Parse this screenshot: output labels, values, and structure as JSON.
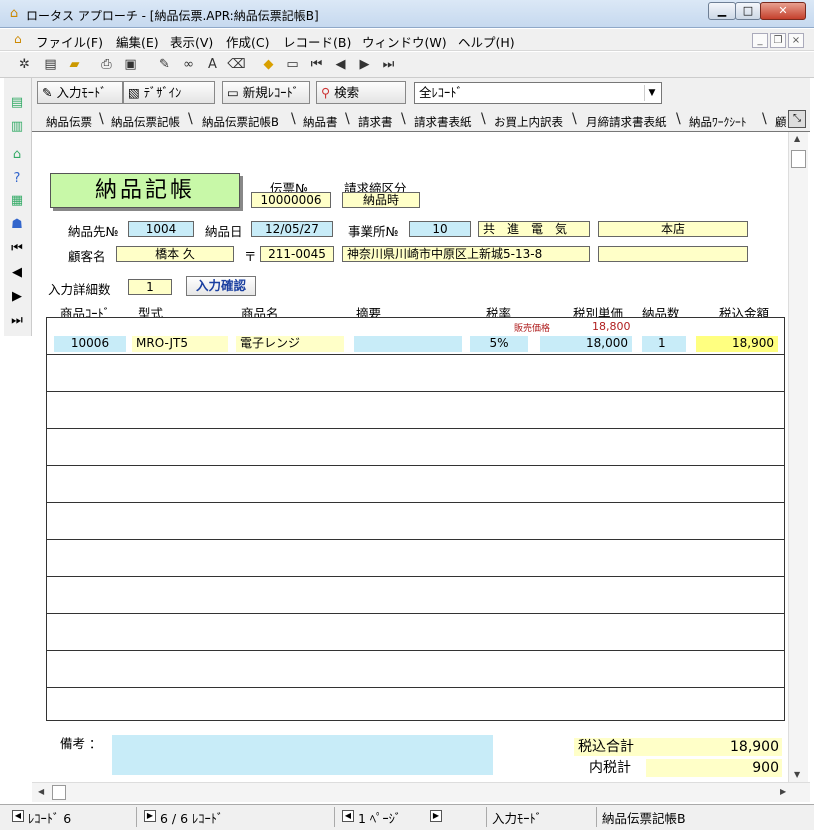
{
  "window": {
    "title": "ロータス アプローチ - [納品伝票.APR:納品伝票記帳B]",
    "min": "▁",
    "max": "□",
    "close": "✕"
  },
  "menu": [
    "ファイル(F)",
    "編集(E)",
    "表示(V)",
    "作成(C)",
    "レコード(B)",
    "ウィンドウ(W)",
    "ヘルプ(H)"
  ],
  "mdi": {
    "min": "_",
    "restore": "❐",
    "close": "×"
  },
  "toolbar2": {
    "input_mode": "入力ﾓｰﾄﾞ",
    "design": "ﾃﾞｻﾞｲﾝ",
    "new_record": "新規ﾚｺｰﾄﾞ",
    "search": "検索",
    "record_filter": "全ﾚｺｰﾄﾞ"
  },
  "tabs": [
    "納品伝票",
    "納品伝票記帳",
    "納品伝票記帳B",
    "納品書",
    "請求書",
    "請求書表紙",
    "お買上内訳表",
    "月締請求書表紙",
    "納品ﾜｰｸｼｰﾄ",
    "顧"
  ],
  "form": {
    "title": "納品記帳",
    "voucher_no_label": "伝票№",
    "voucher_no": "10000006",
    "billing_label": "請求締区分",
    "billing": "納品時",
    "delivery_to_label": "納品先№",
    "delivery_to": "1004",
    "delivery_date_label": "納品日",
    "delivery_date": "12/05/27",
    "office_label": "事業所№",
    "office_no": "10",
    "company": "共　進　電　気",
    "branch": "本店",
    "customer_label": "顧客名",
    "customer": "橋本 久",
    "postal_mark": "〒",
    "postal": "211-0045",
    "address": "神奈川県川崎市中原区上新城5-13-8",
    "address2": "",
    "detail_count_label": "入力詳細数",
    "detail_count": "1",
    "confirm": "入力確認"
  },
  "columns": [
    "商品ｺｰﾄﾞ",
    "型式",
    "商品名",
    "摘要",
    "税率",
    "税別単価",
    "納品数",
    "税込金額"
  ],
  "sale_price_label": "販売価格",
  "sale_price": "18,800",
  "row": {
    "code": "10006",
    "model": "MRO-JT5",
    "name": "電子レンジ",
    "note": "",
    "tax": "5%",
    "unit_price": "18,000",
    "qty": "1",
    "total": "18,900"
  },
  "footer": {
    "memo_label": "備考 ：",
    "memo": "",
    "total_label": "税込合計",
    "total": "18,900",
    "tax_label": "内税計",
    "tax": "900"
  },
  "status": {
    "record": "ﾚｺｰﾄﾞ 6",
    "count": "6 / 6 ﾚｺｰﾄﾞ",
    "page": "1 ﾍﾟｰｼﾞ",
    "mode": "入力ﾓｰﾄﾞ",
    "form": "納品伝票記帳B"
  },
  "colors": {
    "field_blue": "#c8ecf8",
    "field_yellow": "#ffffc8",
    "title_green": "#c8f8a8",
    "sale_red": "#b02020",
    "confirm_blue": "#1a3fa0"
  }
}
